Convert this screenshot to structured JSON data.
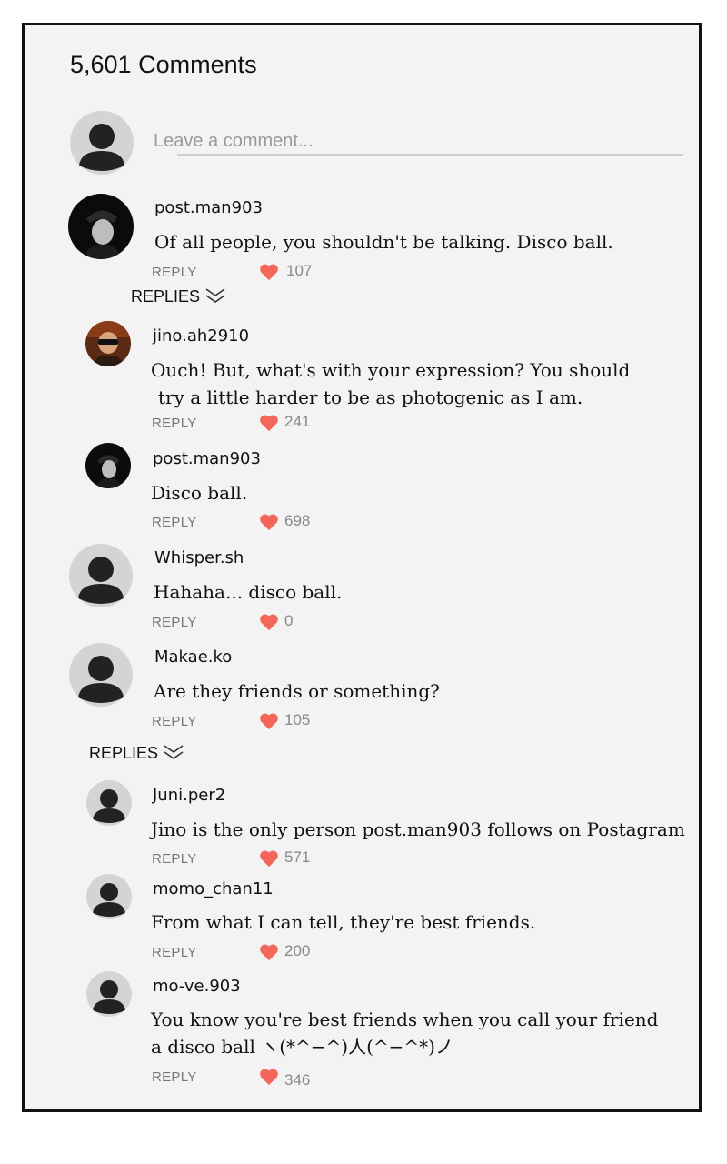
{
  "header": {
    "comment_count_label": "5,601 Comments"
  },
  "composer": {
    "placeholder": "Leave a comment..."
  },
  "colors": {
    "heart": "#f2675a",
    "border": "#111111",
    "panel_bg": "#f3f3f3"
  },
  "icons": {
    "heart": "heart-icon",
    "chevron": "double-chevron-down-icon",
    "default_avatar": "user-silhouette-icon"
  },
  "replies_label": "REPLIES",
  "reply_label": "REPLY",
  "comments": [
    {
      "username": "post.man903",
      "text": "Of all people, you shouldn't be talking. Disco ball.",
      "likes": "107"
    },
    {
      "username": "jino.ah2910",
      "text_line1": "Ouch! But, what's with your expression? You should",
      "text_line2": "try a little harder to be as photogenic as I am.",
      "likes": "241"
    },
    {
      "username": "post.man903",
      "text": "Disco ball.",
      "likes": "698"
    },
    {
      "username": "Whisper.sh",
      "text": "Hahaha... disco ball.",
      "likes": "0"
    },
    {
      "username": "Makae.ko",
      "text": "Are they friends or something?",
      "likes": "105"
    },
    {
      "username": "Juni.per2",
      "text": "Jino is the only person post.man903 follows on Postagram",
      "likes": "571"
    },
    {
      "username": "momo_chan11",
      "text": "From what I can tell, they're best friends.",
      "likes": "200"
    },
    {
      "username": "mo-ve.903",
      "text_line1": "You know you're best friends when you call your friend",
      "text_line2": "a disco ball ヽ(*^−^)人(^−^*)ノ",
      "likes": "346"
    }
  ]
}
